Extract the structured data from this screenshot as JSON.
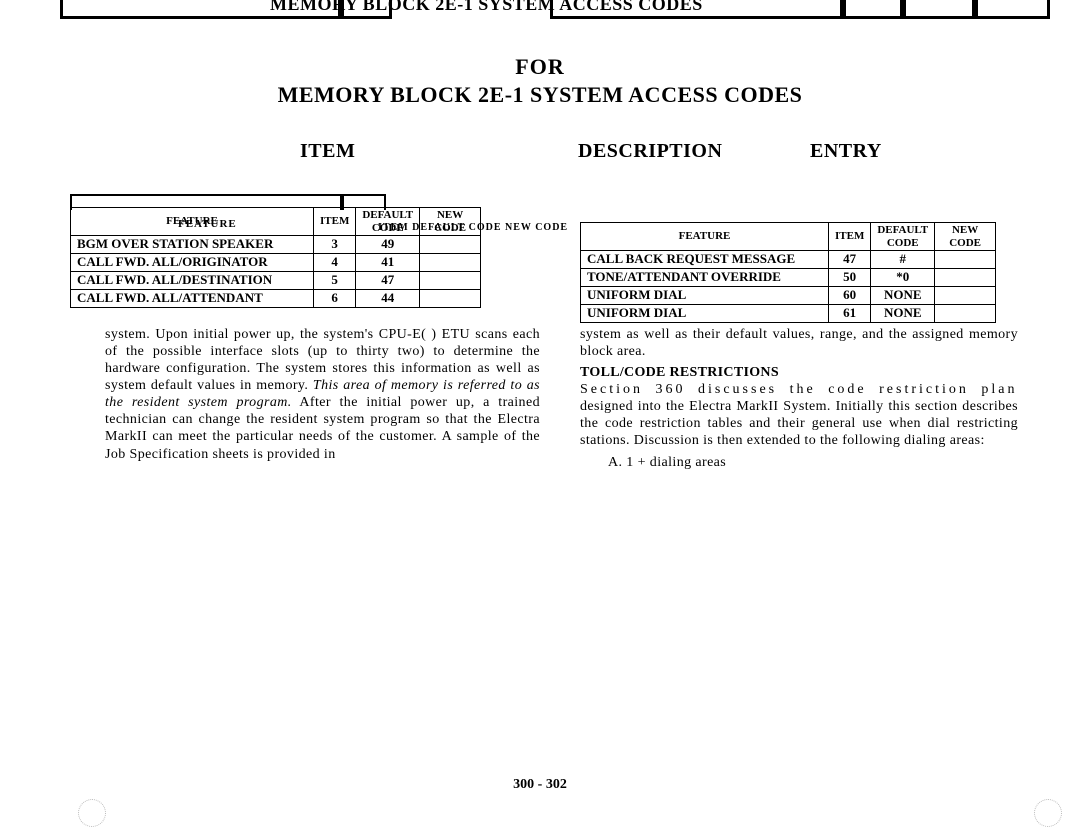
{
  "top_fragment_title": "MEMORY BLOCK 2E-1 SYSTEM ACCESS CODES",
  "header": {
    "for": "FOR",
    "title": "MEMORY BLOCK 2E-1 SYSTEM ACCESS CODES",
    "col_item": "ITEM",
    "col_description": "DESCRIPTION",
    "col_entry": "ENTRY"
  },
  "left_table": {
    "frag_label": "FEATURE",
    "garble_top": "ITEM  DEFAULT CODE  NEW CODE",
    "head": {
      "feature": "FEATURE",
      "item": "ITEM",
      "default_code": "DEFAULT CODE",
      "new_code": "NEW CODE"
    },
    "rows": [
      {
        "feature": "BGM OVER STATION SPEAKER",
        "item": "3",
        "default_code": "49",
        "new_code": ""
      },
      {
        "feature": "CALL FWD. ALL/ORIGINATOR",
        "item": "4",
        "default_code": "41",
        "new_code": ""
      },
      {
        "feature": "CALL FWD. ALL/DESTINATION",
        "item": "5",
        "default_code": "47",
        "new_code": ""
      },
      {
        "feature": "CALL FWD. ALL/ATTENDANT",
        "item": "6",
        "default_code": "44",
        "new_code": ""
      }
    ]
  },
  "right_table": {
    "head": {
      "feature": "FEATURE",
      "item": "ITEM",
      "default_code": "DEFAULT CODE",
      "new_code": "NEW CODE"
    },
    "rows": [
      {
        "feature": "CALL BACK REQUEST MESSAGE",
        "item": "47",
        "default_code": "#",
        "new_code": ""
      },
      {
        "feature": "TONE/ATTENDANT OVERRIDE",
        "item": "50",
        "default_code": "*0",
        "new_code": ""
      },
      {
        "feature": "UNIFORM DIAL",
        "item": "60",
        "default_code": "NONE",
        "new_code": ""
      },
      {
        "feature": "UNIFORM DIAL",
        "item": "61",
        "default_code": "NONE",
        "new_code": ""
      }
    ]
  },
  "left_body": {
    "p1a": "system. Upon initial power up, the system's CPU-E( ) ETU scans each of the possible interface slots (up to thirty two) to determine the hardware configuration. The system stores this information as well as system default values in memory. ",
    "p1_ital": "This area of memory is referred to as the resident system program.",
    "p1b": " After the initial power up, a trained technician can change the resident system program so that the Electra MarkII can meet the particular needs of the customer. A sample of the Job Specification sheets is provided in"
  },
  "right_body": {
    "p1": "system as well as their default values, range, and the assigned memory block area.",
    "subhead": "TOLL/CODE RESTRICTIONS",
    "p2a": "Section 360 discusses the code restriction plan",
    "p2b": "designed into the Electra MarkII System. Initially this section describes the code restriction tables and their general use when dial restricting stations. Discussion is then extended to the following dialing areas:",
    "listA": "A.  1 + dialing areas"
  },
  "page_number": "300 - 302"
}
